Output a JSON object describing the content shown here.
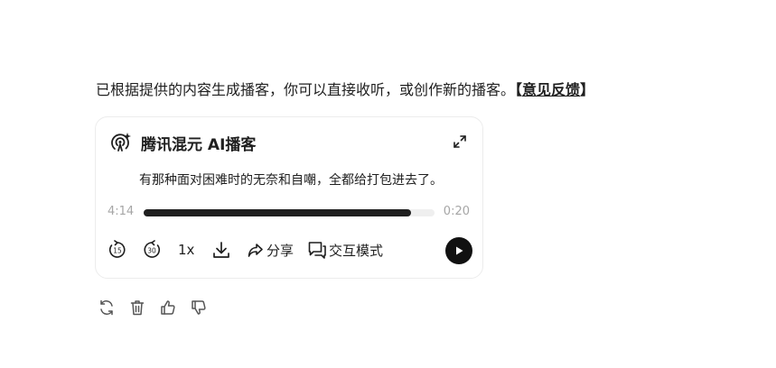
{
  "message": {
    "text": "已根据提供的内容生成播客，你可以直接收听，或创作新的播客。",
    "feedback_open": "【",
    "feedback_label": "意见反馈",
    "feedback_close": "】"
  },
  "podcast_card": {
    "logo_icon": "podcast-sparkle-icon",
    "title": "腾讯混元 AI播客",
    "expand_icon": "expand-icon",
    "transcript": "有那种面对困难时的无奈和自嘲，全都给打包进去了。",
    "current_time": "4:14",
    "duration": "0:20",
    "progress_fraction": 0.92,
    "controls": {
      "rewind_icon": "rewind-15-icon",
      "forward_icon": "forward-30-icon",
      "speed_label": "1x",
      "download_icon": "download-icon",
      "share_label": "分享",
      "interactive_label": "交互模式",
      "play_icon": "play-icon"
    }
  },
  "message_actions": [
    "refresh-icon",
    "delete-icon",
    "thumbs-up-icon",
    "thumbs-down-icon"
  ],
  "colors": {
    "text": "#1f1f1f",
    "muted": "#a6a6a6",
    "track": "#efefef",
    "card_border": "#ececec",
    "play_bg": "#111111"
  }
}
